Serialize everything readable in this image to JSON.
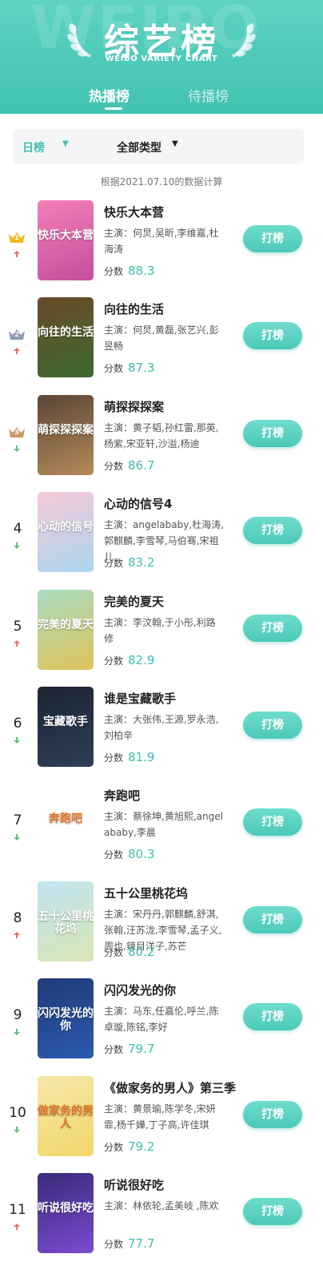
{
  "header": {
    "bg_word": "WEIBO",
    "title": "综艺榜",
    "subtitle": "WEIBO VARIETY CHART",
    "tabs": [
      {
        "label": "热播榜",
        "active": true
      },
      {
        "label": "待播榜",
        "active": false
      }
    ]
  },
  "filter": {
    "period": "日榜",
    "type": "全部类型",
    "chevron": "chevron-down-icon"
  },
  "note": "根据2021.07.10的数据计算",
  "labels": {
    "score": "分数",
    "vote": "打榜"
  },
  "colors": {
    "accent": "#3dbfad",
    "up": "#e8736a",
    "down": "#5cc27a",
    "gold": "#f2b81e",
    "silver": "#8e9bb3",
    "bronze": "#c99a6a"
  },
  "items": [
    {
      "rank": "1",
      "trend": "up",
      "name": "快乐大本营",
      "cast": "主演：何炅,吴昕,李维嘉,杜海涛",
      "score": "88.3",
      "poster_text": "快乐大本营",
      "poster_colors": [
        "#f37fb8",
        "#c44f9c"
      ]
    },
    {
      "rank": "2",
      "trend": "up",
      "name": "向往的生活",
      "cast": "主演：何炅,黄磊,张艺兴,彭昱畅",
      "score": "87.3",
      "poster_text": "向往的生活",
      "poster_colors": [
        "#6a4a2c",
        "#3d6b2f"
      ]
    },
    {
      "rank": "3",
      "trend": "down",
      "name": "萌探探探案",
      "cast": "主演：黄子韬,孙红雷,那英,杨紫,宋亚轩,沙溢,杨迪",
      "score": "86.7",
      "poster_text": "萌探探探案",
      "poster_colors": [
        "#5b4535",
        "#b58a5a"
      ]
    },
    {
      "rank": "4",
      "trend": "down",
      "name": "心动的信号4",
      "cast": "主演：angelababy,杜海涛,郭麒麟,李雪琴,马伯骞,宋祖儿",
      "score": "83.2",
      "poster_text": "心动的信号",
      "poster_colors": [
        "#f7c9d9",
        "#a9d6ee"
      ]
    },
    {
      "rank": "5",
      "trend": "up",
      "name": "完美的夏天",
      "cast": "主演：李汶翰,于小彤,利路修",
      "score": "82.9",
      "poster_text": "完美的夏天",
      "poster_colors": [
        "#a8dcc0",
        "#e0c25a"
      ]
    },
    {
      "rank": "6",
      "trend": "down",
      "name": "谁是宝藏歌手",
      "cast": "主演：大张伟,王源,罗永浩,刘柏辛",
      "score": "81.9",
      "poster_text": "宝藏歌手",
      "poster_colors": [
        "#1b2433",
        "#2f3f57"
      ]
    },
    {
      "rank": "7",
      "trend": "down",
      "name": "奔跑吧",
      "cast": "主演：蔡徐坤,黄旭熙,angelababy,李晨",
      "score": "80.3",
      "poster_text": "奔跑吧",
      "poster_colors": [
        "#ffffff",
        "#ffffff"
      ]
    },
    {
      "rank": "8",
      "trend": "up",
      "name": "五十公里桃花坞",
      "cast": "主演：宋丹丹,郭麒麟,舒淇,张翰,汪苏泷,李雪琴,孟子义,周也,辣目洋子,苏芒",
      "score": "80.2",
      "poster_text": "五十公里桃花坞",
      "poster_colors": [
        "#bfe3f2",
        "#d8e6b4"
      ]
    },
    {
      "rank": "9",
      "trend": "down",
      "name": "闪闪发光的你",
      "cast": "主演：马东,任嘉伦,呼兰,陈卓璇,陈铭,李好",
      "score": "79.7",
      "poster_text": "闪闪发光的你",
      "poster_colors": [
        "#1f3a78",
        "#2c5bb0"
      ]
    },
    {
      "rank": "10",
      "trend": "down",
      "name": "《做家务的男人》第三季",
      "cast": "主演：黄景瑜,陈学冬,宋妍霏,杨千嬅,丁子高,许佳琪",
      "score": "79.2",
      "poster_text": "做家务的男人",
      "poster_colors": [
        "#f6e7a8",
        "#f2d76a"
      ]
    },
    {
      "rank": "11",
      "trend": "up",
      "name": "听说很好吃",
      "cast": "主演：林依轮,孟美岐 ,陈欢",
      "score": "77.7",
      "poster_text": "听说很好吃",
      "poster_colors": [
        "#3b2a7a",
        "#7a4bd0"
      ]
    }
  ]
}
